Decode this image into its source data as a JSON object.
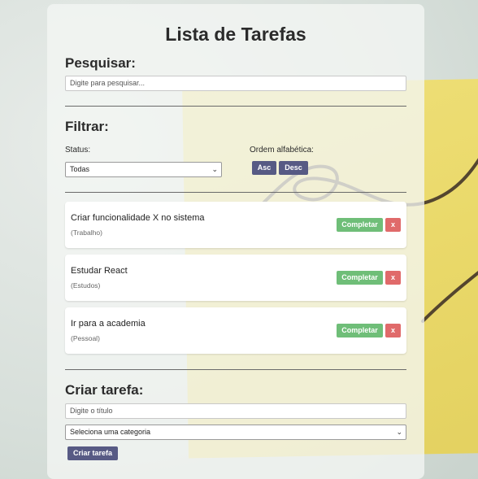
{
  "page_title": "Lista de Tarefas",
  "search": {
    "heading": "Pesquisar:",
    "placeholder": "Digite para pesquisar..."
  },
  "filter": {
    "heading": "Filtrar:",
    "status_label": "Status:",
    "status_selected": "Todas",
    "order_label": "Ordem alfabética:",
    "asc_label": "Asc",
    "desc_label": "Desc"
  },
  "tasks": [
    {
      "title": "Criar funcionalidade X no sistema",
      "category": "(Trabalho)"
    },
    {
      "title": "Estudar React",
      "category": "(Estudos)"
    },
    {
      "title": "Ir para a academia",
      "category": "(Pessoal)"
    }
  ],
  "task_actions": {
    "complete_label": "Completar",
    "delete_label": "x"
  },
  "create": {
    "heading": "Criar tarefa:",
    "title_placeholder": "Digite o título",
    "category_selected": "Seleciona uma categoria",
    "submit_label": "Criar tarefa"
  },
  "colors": {
    "primary_button": "#575a84",
    "complete_button": "#6fbe78",
    "delete_button": "#e06a6a"
  }
}
